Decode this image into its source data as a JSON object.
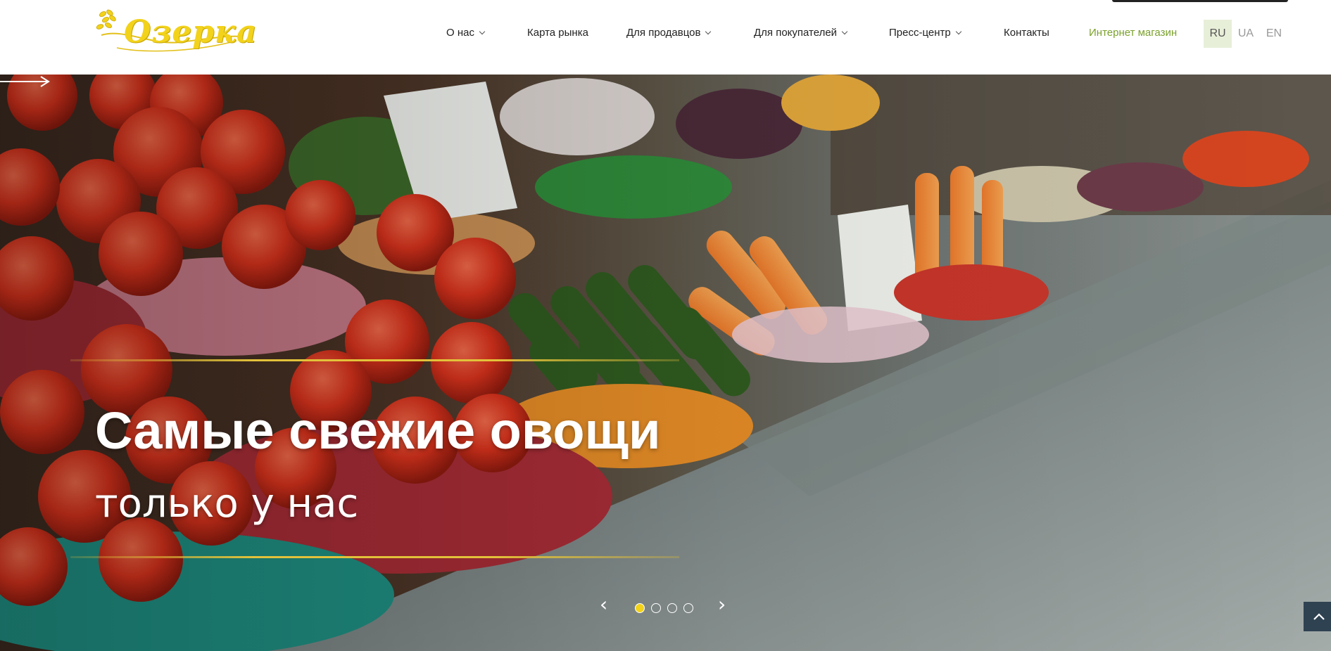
{
  "brand": {
    "logo_text": "Озерка",
    "logo_color": "#f2d21b"
  },
  "nav": {
    "items": [
      {
        "label": "О нас",
        "dropdown": true
      },
      {
        "label": "Карта рынка",
        "dropdown": false
      },
      {
        "label": "Для продавцов",
        "dropdown": true
      },
      {
        "label": "Для покупателей",
        "dropdown": true
      },
      {
        "label": "Пресс-центр",
        "dropdown": true
      },
      {
        "label": "Контакты",
        "dropdown": false
      },
      {
        "label": "Интернет магазин",
        "dropdown": false
      }
    ],
    "shop_color": "#7aa12b"
  },
  "languages": {
    "items": [
      "RU",
      "UA",
      "EN"
    ],
    "active": "RU"
  },
  "hero": {
    "title": "Самые свежие овощи",
    "subtitle": "только у нас",
    "arrow_icon": "long-arrow-right-icon"
  },
  "slider": {
    "prev": "‹",
    "next": "›",
    "total": 4,
    "active_index": 0,
    "accent": "#f2d21b"
  },
  "scroll_top_icon": "chevron-up-icon"
}
